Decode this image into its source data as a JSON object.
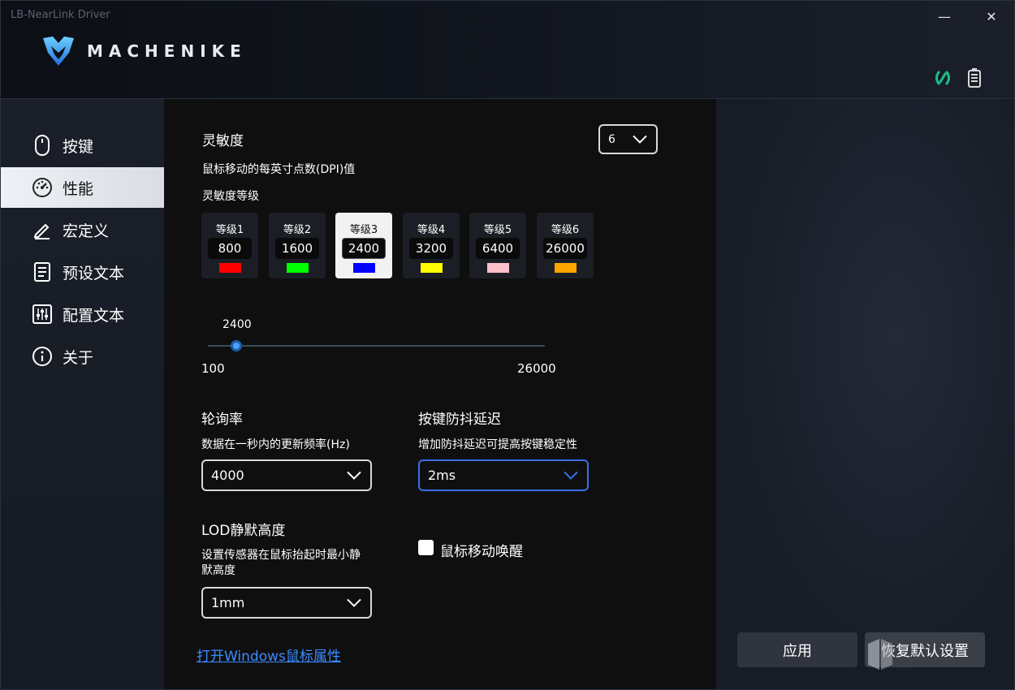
{
  "window": {
    "title": "LB-NearLink Driver",
    "minimize_glyph": "—",
    "close_glyph": "✕"
  },
  "brand": {
    "name": "MACHENIKE",
    "logo_icon": "machenike-logo-icon"
  },
  "header_icons": {
    "link": "link-status-icon",
    "battery": "battery-icon",
    "accent": "#19c08a"
  },
  "sidebar": {
    "items": [
      {
        "label": "按键",
        "icon": "mouse-icon"
      },
      {
        "label": "性能",
        "icon": "speedometer-icon",
        "active": true
      },
      {
        "label": "宏定义",
        "icon": "pen-icon"
      },
      {
        "label": "预设文本",
        "icon": "document-icon"
      },
      {
        "label": "配置文本",
        "icon": "sliders-icon"
      },
      {
        "label": "关于",
        "icon": "info-icon"
      }
    ]
  },
  "sensitivity": {
    "title": "灵敏度",
    "level_count_selected": "6",
    "desc": "鼠标移动的每英寸点数(DPI)值",
    "levels_title": "灵敏度等级",
    "levels": [
      {
        "name": "等级1",
        "value": "800",
        "color": "#ff0000"
      },
      {
        "name": "等级2",
        "value": "1600",
        "color": "#00ff00"
      },
      {
        "name": "等级3",
        "value": "2400",
        "color": "#0000ff",
        "active": true
      },
      {
        "name": "等级4",
        "value": "3200",
        "color": "#ffff00"
      },
      {
        "name": "等级5",
        "value": "6400",
        "color": "#ffc0cb"
      },
      {
        "name": "等级6",
        "value": "26000",
        "color": "#ffa500"
      }
    ],
    "slider": {
      "current": "2400",
      "min": "100",
      "max": "26000"
    }
  },
  "polling": {
    "title": "轮询率",
    "desc": "数据在一秒内的更新频率(Hz)",
    "value": "4000"
  },
  "debounce": {
    "title": "按键防抖延迟",
    "desc": "增加防抖延迟可提高按键稳定性",
    "value": "2ms"
  },
  "lod": {
    "title": "LOD静默高度",
    "desc_line1": "设置传感器在鼠标抬起时最小静",
    "desc_line2": "默高度",
    "value": "1mm"
  },
  "wake": {
    "label": "鼠标移动唤醒",
    "checked": false
  },
  "footer": {
    "link": "打开Windows鼠标属性",
    "apply": "应用",
    "reset": "恢复默认设置"
  }
}
